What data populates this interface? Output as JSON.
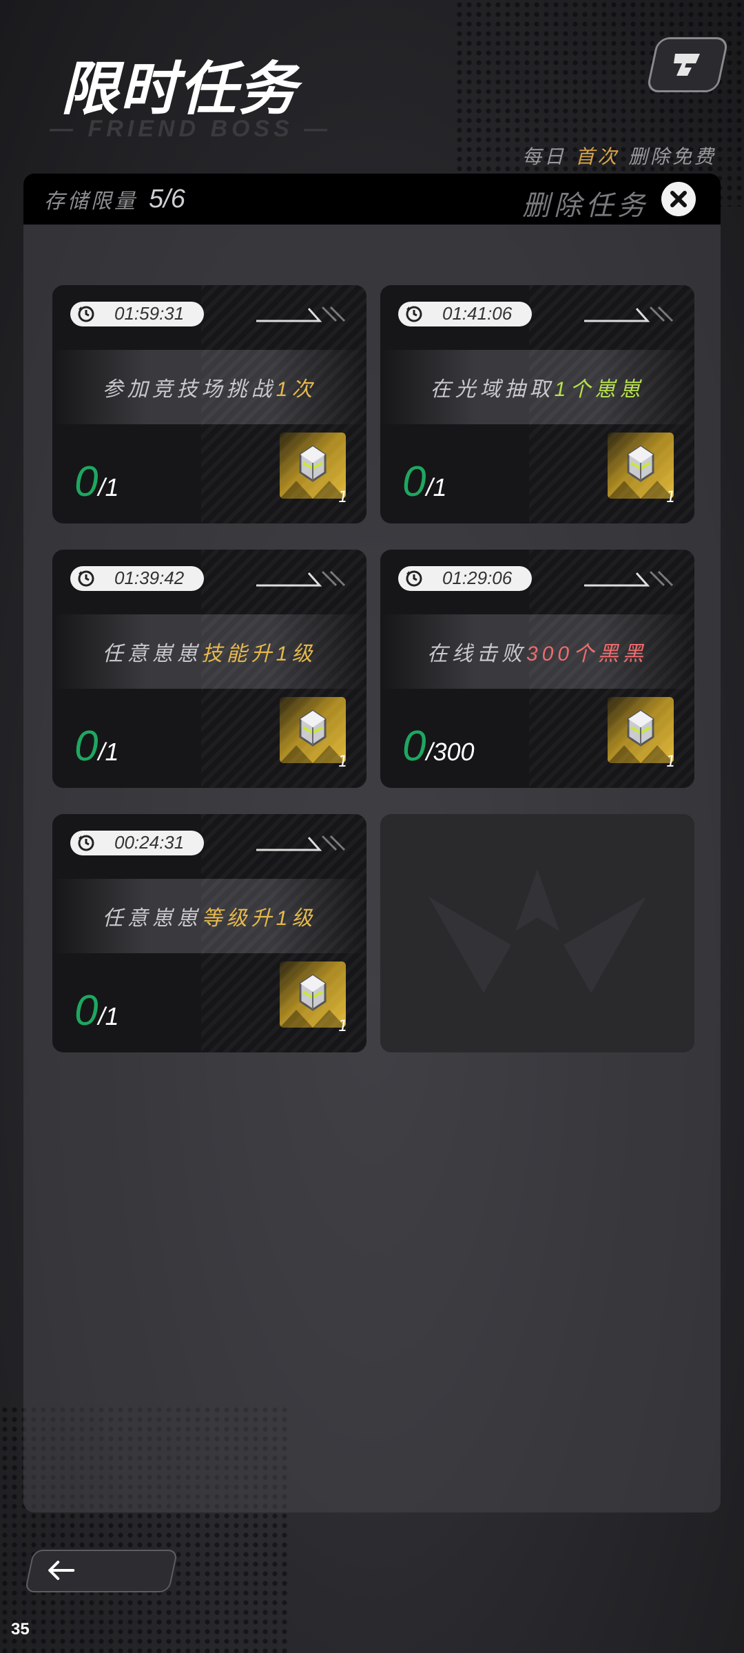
{
  "header": {
    "title": "限时任务",
    "subtitle": "— FRIEND BOSS —"
  },
  "notice": {
    "prefix": "每日",
    "highlight": "首次",
    "suffix": "删除免费"
  },
  "panel": {
    "storage_label": "存储限量",
    "storage_value": "5/6",
    "delete_label": "删除任务"
  },
  "tasks": [
    {
      "timer": "01:59:31",
      "text_before": "参加竞技场挑战",
      "text_highlight": "1次",
      "text_after": "",
      "highlight_color": "#e6b84a",
      "current": "0",
      "total": "/1",
      "reward_count": "1"
    },
    {
      "timer": "01:41:06",
      "text_before": "在光域抽取",
      "text_highlight": "1个崽崽",
      "text_after": "",
      "highlight_color": "#b7e04a",
      "current": "0",
      "total": "/1",
      "reward_count": "1"
    },
    {
      "timer": "01:39:42",
      "text_before": "任意崽崽",
      "text_highlight": "技能升1级",
      "text_after": "",
      "highlight_color": "#e6b84a",
      "current": "0",
      "total": "/1",
      "reward_count": "1"
    },
    {
      "timer": "01:29:06",
      "text_before": "在线击败",
      "text_highlight": "300个黑黑",
      "text_after": "",
      "highlight_color": "#f06a6a",
      "current": "0",
      "total": "/300",
      "reward_count": "1"
    },
    {
      "timer": "00:24:31",
      "text_before": "任意崽崽",
      "text_highlight": "等级升1级",
      "text_after": "",
      "highlight_color": "#e6b84a",
      "current": "0",
      "total": "/1",
      "reward_count": "1"
    }
  ],
  "footer": {
    "page_number": "35"
  }
}
